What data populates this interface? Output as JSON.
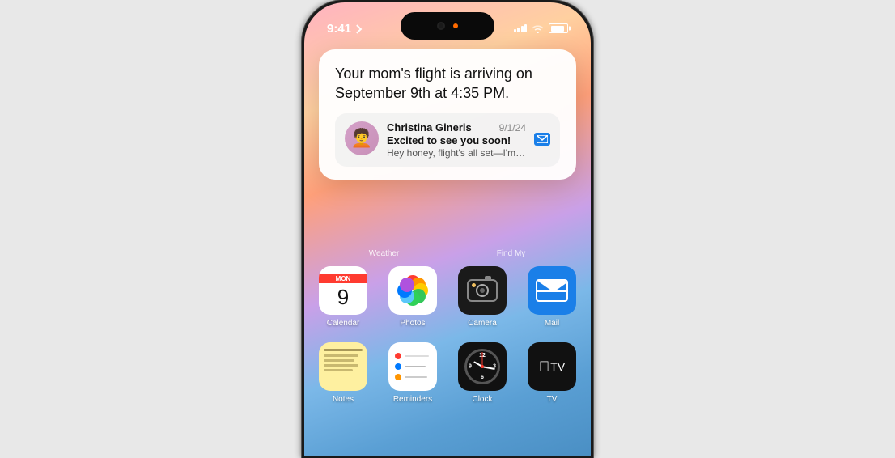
{
  "background": "#e8e8e8",
  "phone": {
    "status_bar": {
      "time": "9:41",
      "signal_label": "signal",
      "wifi_label": "wifi",
      "battery_label": "battery"
    },
    "notification": {
      "main_text": "Your mom's flight is arriving on September 9th at 4:35 PM.",
      "contact_name": "Christina Gineris",
      "contact_date": "9/1/24",
      "message_subject": "Excited to see you soon!",
      "message_preview": "Hey honey, flight's all set—I'm takin...",
      "contact_emoji": "🧑‍🦱"
    },
    "widget_labels": {
      "weather": "Weather",
      "find_my": "Find My"
    },
    "apps": {
      "row1": [
        {
          "name": "Calendar",
          "type": "calendar",
          "day": "MON",
          "date": "9"
        },
        {
          "name": "Photos",
          "type": "photos"
        },
        {
          "name": "Camera",
          "type": "camera"
        },
        {
          "name": "Mail",
          "type": "mail"
        }
      ],
      "row2": [
        {
          "name": "Notes",
          "type": "notes"
        },
        {
          "name": "Reminders",
          "type": "reminders"
        },
        {
          "name": "Clock",
          "type": "clock"
        },
        {
          "name": "TV",
          "type": "tv"
        }
      ]
    }
  }
}
